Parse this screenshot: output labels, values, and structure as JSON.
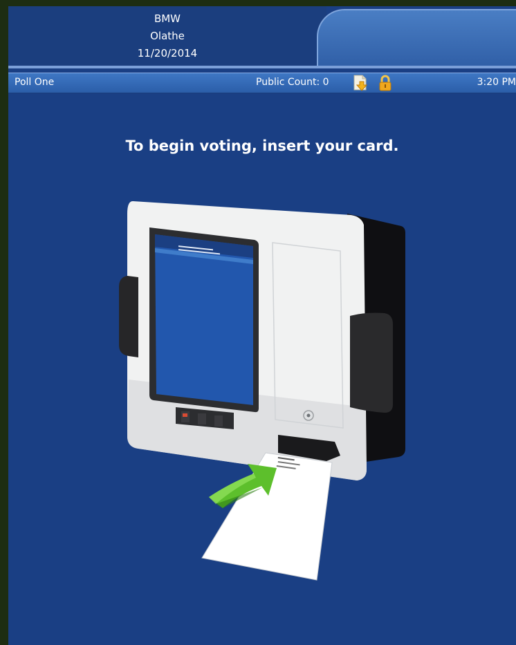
{
  "header": {
    "line1": "BMW",
    "line2": "Olathe",
    "line3": "11/20/2014"
  },
  "status_bar": {
    "poll_name": "Poll One",
    "public_count": "Public Count: 0",
    "time": "3:20 PM"
  },
  "icons": {
    "document": "document-icon",
    "lock": "lock-icon"
  },
  "main": {
    "instruction": "To begin voting, insert your card."
  },
  "colors": {
    "background": "#1a3f84",
    "statusbar": "#3e77c4",
    "arrow": "#5dbf2c"
  }
}
